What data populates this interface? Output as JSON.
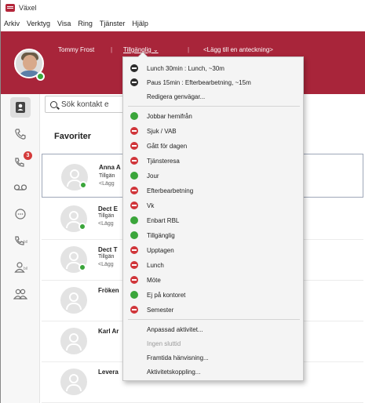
{
  "window": {
    "title": "Växel"
  },
  "menubar": [
    "Arkiv",
    "Verktyg",
    "Visa",
    "Ring",
    "Tjänster",
    "Hjälp"
  ],
  "header": {
    "user_name": "Tommy Frost",
    "separator": "|",
    "status": "Tillgänglig",
    "status_caret": "⌄",
    "note": "<Lägg till en anteckning>"
  },
  "rail": {
    "voicemail_badge": "3",
    "missed_sub": "bil",
    "contacts_sub": "bil"
  },
  "search": {
    "text": "Sök kontakt e"
  },
  "favorites": {
    "title": "Favoriter"
  },
  "contacts": [
    {
      "name": "Anna A",
      "line1": "Tillgän",
      "note": "<Lägg",
      "presence": "green"
    },
    {
      "name": "Dect E",
      "line1": "Tillgän",
      "note": "<Lägg",
      "presence": "green"
    },
    {
      "name": "Dect T",
      "line1": "Tillgän",
      "note": "<Lägg",
      "presence": "green"
    },
    {
      "name": "Fröken",
      "line1": "",
      "note": "",
      "presence": ""
    },
    {
      "name": "Karl Ar",
      "line1": "",
      "note": "",
      "presence": ""
    },
    {
      "name": "Levera",
      "line1": "",
      "note": "",
      "presence": ""
    }
  ],
  "status_menu": {
    "quick": [
      {
        "label": "Lunch 30min : Lunch, ~30m",
        "icon": "dark"
      },
      {
        "label": "Paus 15min : Efterbearbetning, ~15m",
        "icon": "dark"
      },
      {
        "label": "Redigera genvägar...",
        "icon": ""
      }
    ],
    "statuses": [
      {
        "label": "Jobbar hemifrån",
        "icon": "green"
      },
      {
        "label": "Sjuk / VAB",
        "icon": "red"
      },
      {
        "label": "Gått för dagen",
        "icon": "red"
      },
      {
        "label": "Tjänsteresa",
        "icon": "red"
      },
      {
        "label": "Jour",
        "icon": "green"
      },
      {
        "label": "Efterbearbetning",
        "icon": "red"
      },
      {
        "label": "Vk",
        "icon": "red"
      },
      {
        "label": "Enbart RBL",
        "icon": "green"
      },
      {
        "label": "Tillgänglig",
        "icon": "green"
      },
      {
        "label": "Upptagen",
        "icon": "red"
      },
      {
        "label": "Lunch",
        "icon": "red"
      },
      {
        "label": "Möte",
        "icon": "red"
      },
      {
        "label": "Ej på kontoret",
        "icon": "green"
      },
      {
        "label": "Semester",
        "icon": "red"
      }
    ],
    "actions": [
      {
        "label": "Anpassad aktivitet...",
        "disabled": false
      },
      {
        "label": "Ingen sluttid",
        "disabled": true
      },
      {
        "label": "Framtida hänvisning...",
        "disabled": false
      },
      {
        "label": "Aktivitetskoppling...",
        "disabled": false
      }
    ]
  },
  "colors": {
    "brand": "#a8253a",
    "available": "#3aa53a",
    "busy": "#d0353a",
    "shortcut": "#2b2b2b"
  }
}
